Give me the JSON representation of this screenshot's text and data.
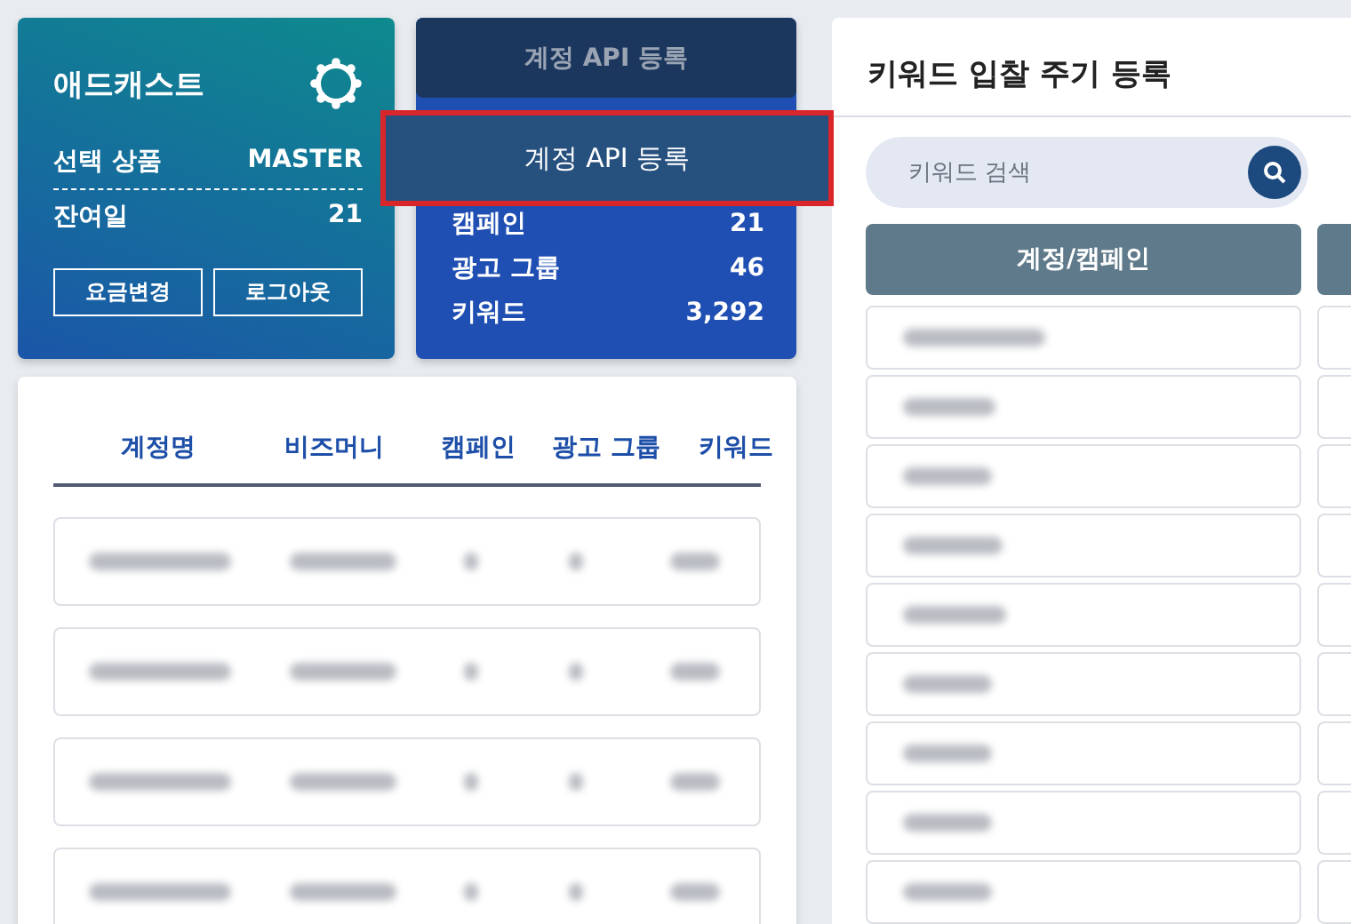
{
  "account_card": {
    "title": "애드캐스트",
    "rows": [
      {
        "label": "선택 상품",
        "value": "MASTER"
      },
      {
        "label": "잔여일",
        "value": "21"
      }
    ],
    "buttons": [
      "요금변경",
      "로그아웃"
    ]
  },
  "stats_card": {
    "tab": "계정 API 등록",
    "rows": [
      {
        "label": "캠페인",
        "value": "21"
      },
      {
        "label": "광고 그룹",
        "value": "46"
      },
      {
        "label": "키워드",
        "value": "3,292"
      }
    ]
  },
  "popup": {
    "label": "계정 API 등록",
    "highlighted": true
  },
  "accounts_table": {
    "columns": [
      "계정명",
      "비즈머니",
      "캠페인",
      "광고 그룹",
      "키워드"
    ],
    "rows": [
      {
        "redacted": true
      },
      {
        "redacted": true
      },
      {
        "redacted": true
      },
      {
        "redacted": true
      }
    ]
  },
  "bid_panel": {
    "title": "키워드 입찰 주기 등록",
    "search": {
      "placeholder": "키워드 검색"
    },
    "columns": [
      "계정/캠페인"
    ],
    "rows": [
      {
        "redacted": true
      },
      {
        "redacted": true
      },
      {
        "redacted": true
      },
      {
        "redacted": true
      },
      {
        "redacted": true
      },
      {
        "redacted": true
      },
      {
        "redacted": true
      },
      {
        "redacted": true
      },
      {
        "redacted": true
      }
    ]
  }
}
